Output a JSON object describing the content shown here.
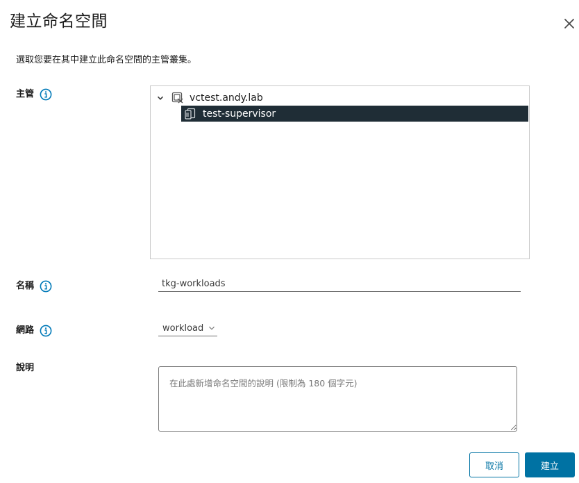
{
  "dialog": {
    "title": "建立命名空間",
    "description": "選取您要在其中建立此命名空間的主管叢集。"
  },
  "supervisor": {
    "label": "主管",
    "tree": {
      "root": {
        "label": "vctest.andy.lab",
        "expanded": true
      },
      "children": [
        {
          "label": "test-supervisor",
          "selected": true
        }
      ]
    }
  },
  "name": {
    "label": "名稱",
    "value": "tkg-workloads"
  },
  "network": {
    "label": "網路",
    "selected": "workload"
  },
  "description_field": {
    "label": "說明",
    "placeholder": "在此處新增命名空間的說明 (限制為 180 個字元)"
  },
  "buttons": {
    "cancel": "取消",
    "create": "建立"
  },
  "colors": {
    "accent": "#0072a3",
    "selected_row": "#1f2d36",
    "info_icon": "#0079b8"
  }
}
